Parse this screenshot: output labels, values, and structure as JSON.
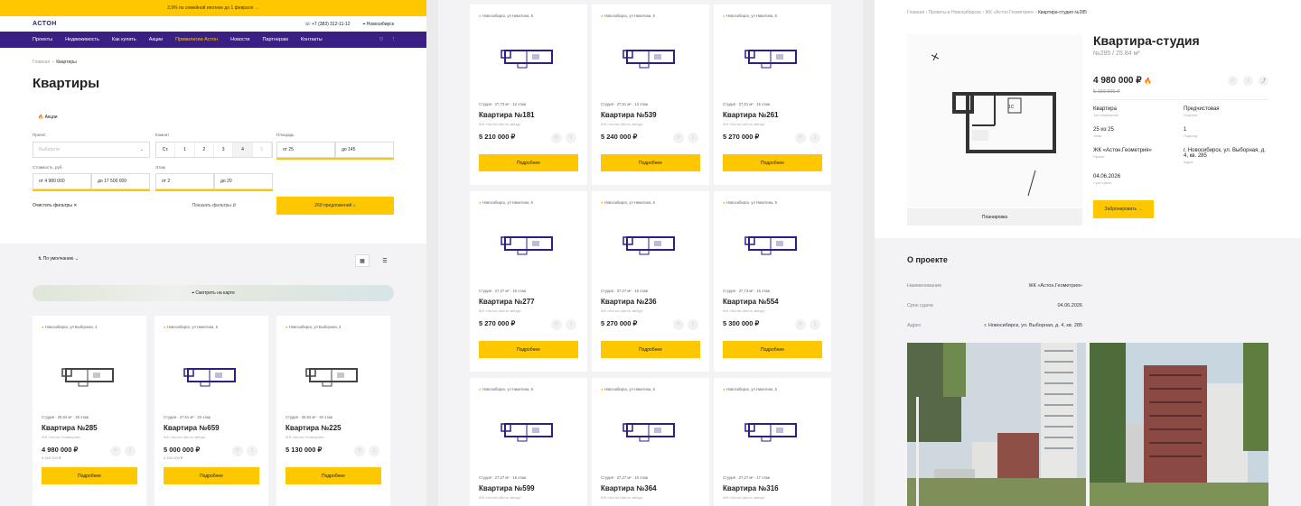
{
  "p1": {
    "promo": "3,9% по семейной ипотеке до 1 февраля →",
    "logo": "АСТОН",
    "phone": "+7 (383) 312-11-12",
    "city": "Новосибирск",
    "nav": [
      "Проекты",
      "Недвижимость",
      "Как купить",
      "Акции",
      "Привилегии Астон",
      "Новости",
      "Партнерам",
      "Контакты"
    ],
    "breadcrumb": [
      "Главная",
      "Квартиры"
    ],
    "title": "Квартиры",
    "promo_tag": "Акции",
    "f": {
      "project_lbl": "Проект",
      "project_ph": "Выберите",
      "rooms_lbl": "Комнат",
      "rooms": [
        "Ст.",
        "1",
        "2",
        "3",
        "4",
        "5"
      ],
      "area_lbl": "Площадь",
      "area_from": "от  25",
      "area_to": "до  145",
      "price_lbl": "Стоимость, руб.",
      "price_from": "от  4 980 000",
      "price_to": "до  17 500 000",
      "floor_lbl": "Этаж",
      "floor_from": "от  2",
      "floor_to": "до  20",
      "clear": "Очистить фильтры",
      "show": "Показать фильтры",
      "offers": "269 предложений"
    },
    "sort": "По умолчанию",
    "map": "Смотреть на карте",
    "cards": [
      {
        "addr": "Новосибирск, ул Выборная, 4",
        "meta": "Студия  ·  25,84 м²  ·  25 этаж",
        "title": "Квартира №285",
        "sub": "ЖК «Астон.Геометрия»",
        "price": "4 980 000 ₽",
        "old": "5 160 000 ₽",
        "btn": "Подробнее"
      },
      {
        "addr": "Новосибирск, ул Никитина, 5",
        "meta": "Студия  ·  27,51 м²  ·  23 этаж",
        "title": "Квартира №659",
        "sub": "ЖК «Астон.Шесть звёзд»",
        "price": "5 000 000 ₽",
        "old": "5 160 000 ₽",
        "btn": "Подробнее"
      },
      {
        "addr": "Новосибирск, ул Выборная, 4",
        "meta": "Студия  ·  25,84 м²  ·  20 этаж",
        "title": "Квартира №225",
        "sub": "ЖК «Астон.Геометрия»",
        "price": "5 130 000 ₽",
        "old": "",
        "btn": "Подробнее"
      }
    ]
  },
  "p2": {
    "cards": [
      {
        "addr": "Новосибирск, ул Никитина, 5",
        "meta": "Студия  ·  27,73 м²  ·  12 этаж",
        "title": "Квартира №181",
        "sub": "ЖК «Астон.Шесть звёзд»",
        "price": "5 210 000 ₽",
        "btn": "Подробнее"
      },
      {
        "addr": "Новосибирск, ул Никитина, 5",
        "meta": "Студия  ·  27,51 м²  ·  13 этаж",
        "title": "Квартира №539",
        "sub": "ЖК «Астон.Шесть звёзд»",
        "price": "5 240 000 ₽",
        "btn": "Подробнее"
      },
      {
        "addr": "Новосибирск, ул Никитина, 5",
        "meta": "Студия  ·  27,51 м²  ·  15 этаж",
        "title": "Квартира №261",
        "sub": "ЖК «Астон.Шесть звёзд»",
        "price": "5 270 000 ₽",
        "btn": "Подробнее"
      },
      {
        "addr": "Новосибирск, ул Никитина, 5",
        "meta": "Студия  ·  27,27 м²  ·  15 этаж",
        "title": "Квартира №277",
        "sub": "ЖК «Астон.Шесть звёзд»",
        "price": "5 270 000 ₽",
        "btn": "Подробнее"
      },
      {
        "addr": "Новосибирск, ул Никитина, 5",
        "meta": "Студия  ·  27,27 м²  ·  16 этаж",
        "title": "Квартира №236",
        "sub": "ЖК «Астон.Шесть звёзд»",
        "price": "5 270 000 ₽",
        "btn": "Подробнее"
      },
      {
        "addr": "Новосибирск, ул Никитина, 5",
        "meta": "Студия  ·  27,73 м²  ·  15 этаж",
        "title": "Квартира №554",
        "sub": "ЖК «Астон.Шесть звёзд»",
        "price": "5 300 000 ₽",
        "btn": "Подробнее"
      },
      {
        "addr": "Новосибирск, ул Никитина, 5",
        "meta": "Студия  ·  27,27 м²  ·  16 этаж",
        "title": "Квартира №599",
        "sub": "ЖК «Астон.Шесть звёзд»",
        "price": "",
        "btn": ""
      },
      {
        "addr": "Новосибирск, ул Никитина, 5",
        "meta": "Студия  ·  27,27 м²  ·  16 этаж",
        "title": "Квартира №364",
        "sub": "ЖК «Астон.Шесть звёзд»",
        "price": "",
        "btn": ""
      },
      {
        "addr": "Новосибирск, ул Никитина, 5",
        "meta": "Студия  ·  27,27 м²  ·  17 этаж",
        "title": "Квартира №316",
        "sub": "ЖК «Астон.Шесть звёзд»",
        "price": "",
        "btn": ""
      }
    ]
  },
  "p3": {
    "breadcrumb": [
      "Главная",
      "Проекты в Новосибирске",
      "ЖК «Астон.Геометрия»",
      "Квартира-студия №285"
    ],
    "title": "Квартира-студия",
    "subtitle": "№285 / 25.84 м²",
    "price": "4 980 000 ₽",
    "old": "5 160 000 ₽",
    "plan_tab": "Планировка",
    "specs": [
      {
        "v": "Квартира",
        "l": "Тип помещения"
      },
      {
        "v": "Предчистовая",
        "l": "Отделка"
      },
      {
        "v": "25 из 25",
        "l": "Этаж"
      },
      {
        "v": "1",
        "l": "Подъезд"
      },
      {
        "v": "ЖК «Астон.Геометрия»",
        "l": "Проект"
      },
      {
        "v": "г. Новосибирск, ул. Выборная, д. 4, кв. 285",
        "l": "Адрес"
      },
      {
        "v": "04.06.2026",
        "l": "Срок сдачи"
      }
    ],
    "book": "Забронировать →",
    "about_title": "О проекте",
    "rows": [
      {
        "k": "Наименование",
        "v": "ЖК «Астон.Геометрия»"
      },
      {
        "k": "Срок сдачи",
        "v": "04.06.2026"
      },
      {
        "k": "Адрес",
        "v": "г. Новосибирск, ул. Выборная, д. 4, кв. 285"
      }
    ]
  }
}
